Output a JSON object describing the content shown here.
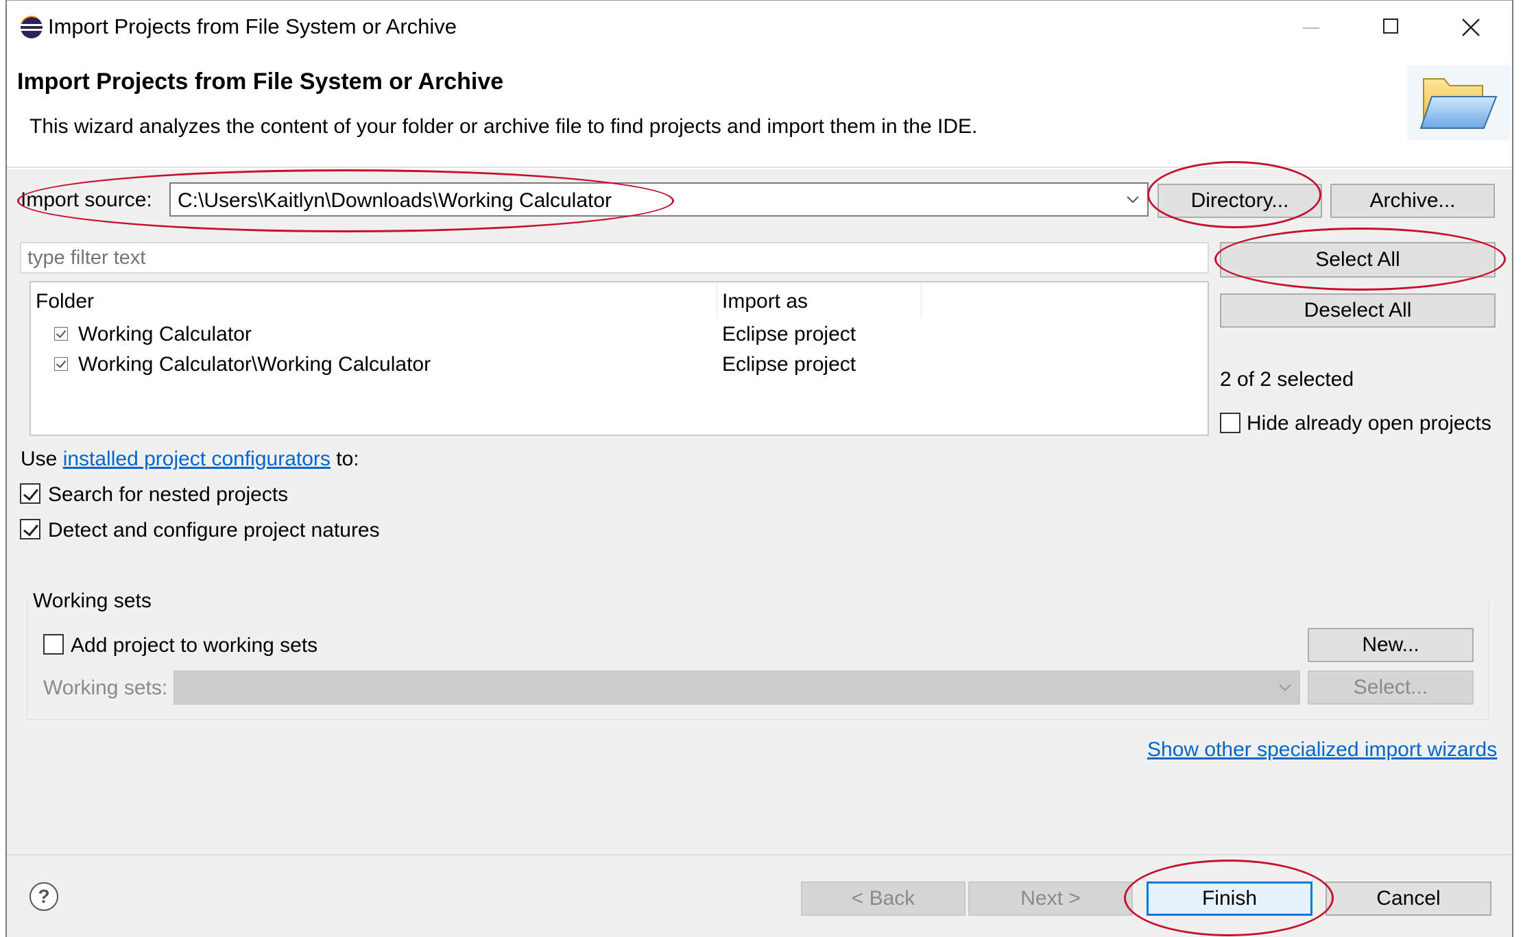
{
  "window": {
    "title": "Import Projects from File System or Archive",
    "icon": "eclipse-icon",
    "controls": {
      "minimize": "—",
      "maximize": "☐",
      "close": "✕"
    }
  },
  "banner": {
    "heading": "Import Projects from File System or Archive",
    "description": "This wizard analyzes the content of your folder or archive file to find projects and import them in the IDE.",
    "icon": "folder-icon"
  },
  "source": {
    "label": "Import source:",
    "value": "C:\\Users\\Kaitlyn\\Downloads\\Working Calculator",
    "directory_button": "Directory...",
    "archive_button": "Archive..."
  },
  "filter": {
    "placeholder": "type filter text"
  },
  "table": {
    "columns": [
      "Folder",
      "Import as"
    ],
    "rows": [
      {
        "folder": "Working Calculator",
        "import_as": "Eclipse project",
        "checked": true
      },
      {
        "folder": "Working Calculator\\Working Calculator",
        "import_as": "Eclipse project",
        "checked": true
      }
    ]
  },
  "side": {
    "select_all": "Select All",
    "deselect_all": "Deselect All",
    "selected_count": "2 of 2 selected",
    "hide_open_label": "Hide already open projects"
  },
  "configurators": {
    "prefix": "Use ",
    "link": "installed project configurators",
    "suffix": " to:",
    "search_nested": "Search for nested projects",
    "detect_natures": "Detect and configure project natures"
  },
  "working_sets": {
    "group_label": "Working sets",
    "add_label": "Add project to working sets",
    "sets_label": "Working sets:",
    "new_button": "New...",
    "select_button": "Select..."
  },
  "other_wizards_link": "Show other specialized import wizards",
  "footer": {
    "back": "< Back",
    "next": "Next >",
    "finish": "Finish",
    "cancel": "Cancel",
    "help_icon": "help-icon"
  },
  "colors": {
    "annotation_red": "#c8102e",
    "link_blue": "#0066cc",
    "dialog_bg": "#f0f0f0"
  }
}
